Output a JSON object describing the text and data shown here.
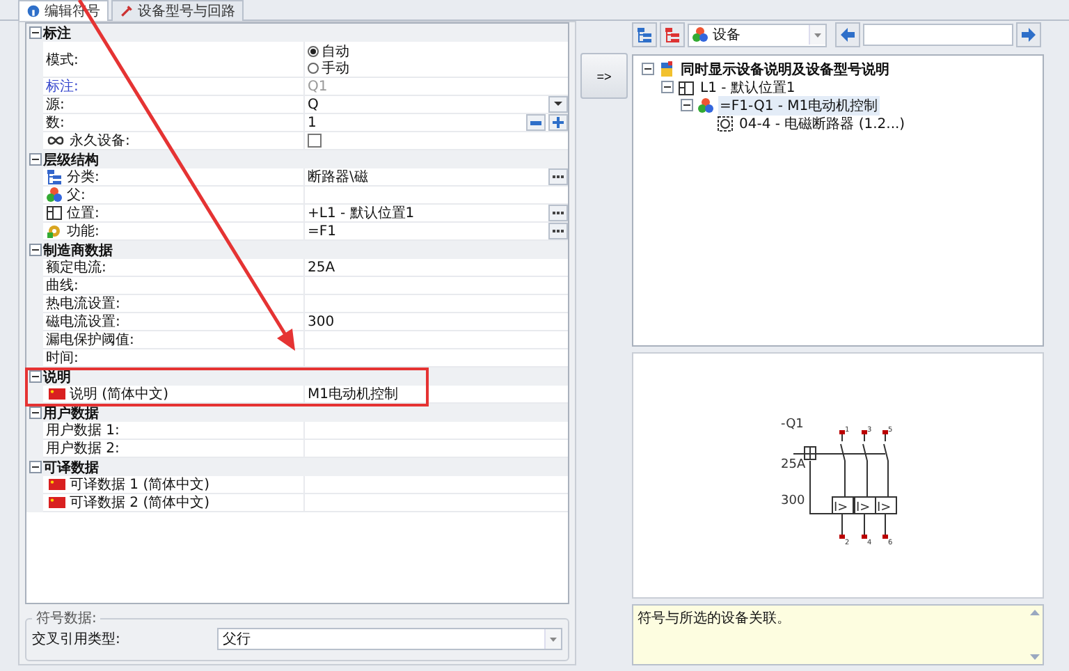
{
  "tabs": [
    {
      "label": "编辑符号",
      "selected": true
    },
    {
      "label": "设备型号与回路",
      "selected": false
    }
  ],
  "property_groups": [
    {
      "title": "标注",
      "expanded": true,
      "rows": [
        {
          "kind": "radio",
          "label": "模式:",
          "options": [
            {
              "label": "自动",
              "selected": true
            },
            {
              "label": "手动",
              "selected": false
            }
          ]
        },
        {
          "kind": "readonly",
          "label": "标注:",
          "value": "Q1"
        },
        {
          "kind": "dropdown",
          "label": "源:",
          "value": "Q"
        },
        {
          "kind": "spin",
          "label": "数:",
          "value": "1"
        },
        {
          "kind": "checkbox",
          "label": "永久设备:",
          "checked": false
        }
      ]
    },
    {
      "title": "层级结构",
      "expanded": true,
      "rows": [
        {
          "kind": "browse",
          "label": "分类:",
          "value": "断路器\\磁"
        },
        {
          "kind": "text",
          "label": "父:"
        },
        {
          "kind": "browse",
          "label": "位置:",
          "value": "+L1 - 默认位置1"
        },
        {
          "kind": "browse",
          "label": "功能:",
          "value": "=F1"
        }
      ]
    },
    {
      "title": "制造商数据",
      "expanded": true,
      "rows": [
        {
          "kind": "text",
          "label": "额定电流:",
          "value": "25A"
        },
        {
          "kind": "text",
          "label": "曲线:"
        },
        {
          "kind": "text",
          "label": "热电流设置:"
        },
        {
          "kind": "text",
          "label": "磁电流设置:",
          "value": "300"
        },
        {
          "kind": "text",
          "label": "漏电保护阈值:"
        },
        {
          "kind": "text",
          "label": "时间:"
        }
      ]
    },
    {
      "title": "说明",
      "expanded": true,
      "rows": [
        {
          "kind": "text",
          "label": "说明 (简体中文)",
          "value": "M1电动机控制"
        }
      ]
    },
    {
      "title": "用户数据",
      "expanded": true,
      "rows": [
        {
          "kind": "text",
          "label": "用户数据 1:"
        },
        {
          "kind": "text",
          "label": "用户数据 2:"
        }
      ]
    },
    {
      "title": "可译数据",
      "expanded": true,
      "rows": [
        {
          "kind": "text",
          "label": "可译数据 1 (简体中文)"
        },
        {
          "kind": "text",
          "label": "可译数据 2 (简体中文)"
        }
      ]
    }
  ],
  "symbol_data": {
    "legend": "符号数据:",
    "cross_reference_label": "交叉引用类型:",
    "cross_reference_value": "父行"
  },
  "transfer_button": "=>",
  "view_selector": {
    "value": "设备"
  },
  "tree": [
    {
      "label": "同时显示设备说明及设备型号说明",
      "expanded": true,
      "selected": false,
      "children": [
        {
          "label": "L1 - 默认位置1",
          "expanded": true,
          "selected": false,
          "children": [
            {
              "label": "=F1-Q1 - M1电动机控制",
              "expanded": true,
              "selected": true,
              "children": [
                {
                  "label": "04-4 - 电磁断路器 (1.2...)",
                  "selected": false
                }
              ]
            }
          ]
        }
      ]
    }
  ],
  "diagram": {
    "device_label": "-Q1",
    "ratings": [
      "25A",
      "300"
    ],
    "top_pins": [
      "1",
      "3",
      "5"
    ],
    "bottom_pins": [
      "2",
      "4",
      "6"
    ],
    "trip_labels": [
      "I>",
      "I>",
      "I>"
    ]
  },
  "message": "符号与所选的设备关联。"
}
